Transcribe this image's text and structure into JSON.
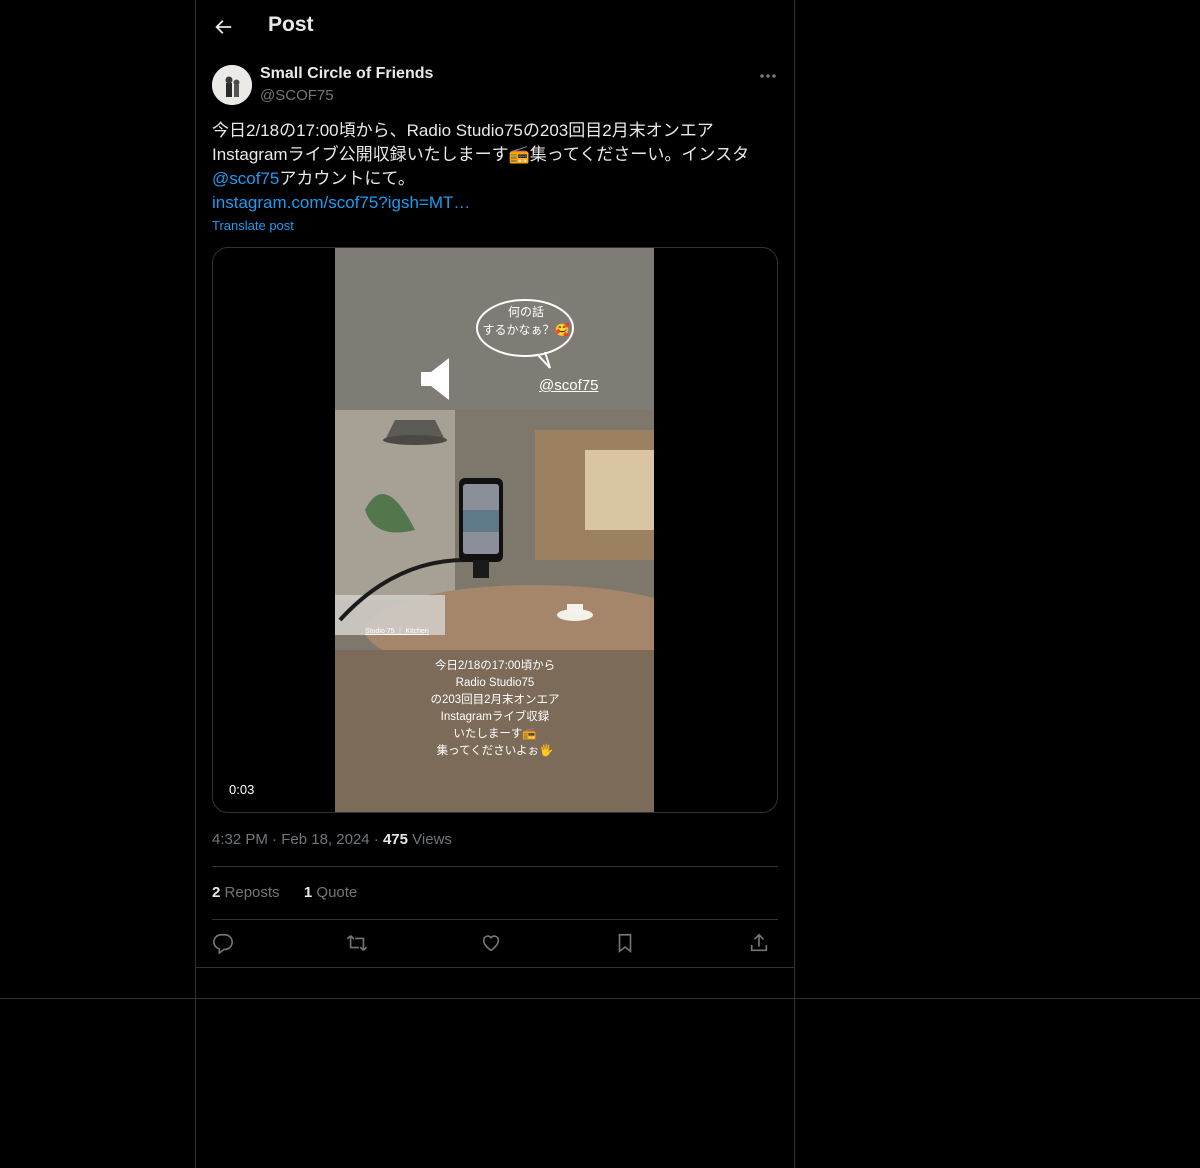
{
  "header": {
    "title": "Post",
    "back_icon": "back-arrow-icon"
  },
  "author": {
    "name": "Small Circle of Friends",
    "handle": "@SCOF75"
  },
  "tweet": {
    "line1": "今日2/18の17:00頃から、Radio Studio75の203回目2月末オンエア",
    "line2a": "Instagramライブ公開収録いたしまーす",
    "line2b": "集ってくださーい。インスタ",
    "mention": "@scof75",
    "line3b": "アカウントにて。",
    "link": "instagram.com/scof75?igsh=MT…",
    "translate": "Translate post"
  },
  "media": {
    "bubble_text_1": "何の話",
    "bubble_text_2": "するかなぁ？🥰",
    "tag": "@scof75",
    "credit": "Studio 75 ｜ Kitchen",
    "caption": "今日2/18の17:00頃から\nRadio Studio75\nの203回目2月末オンエア\nInstagramライブ収録\nいたしまーす📻\n集ってくださいよぉ🖐",
    "timer": "0:03"
  },
  "meta": {
    "time": "4:32 PM",
    "date": "Feb 18, 2024",
    "views_count": "475",
    "views_label": "Views"
  },
  "stats": {
    "reposts_count": "2",
    "reposts_label": "Reposts",
    "quotes_count": "1",
    "quotes_label": "Quote"
  },
  "colors": {
    "background": "#000000",
    "text": "#e7e9ea",
    "muted": "#71767b",
    "accent": "#1d9bf0",
    "border": "#2f3336"
  }
}
